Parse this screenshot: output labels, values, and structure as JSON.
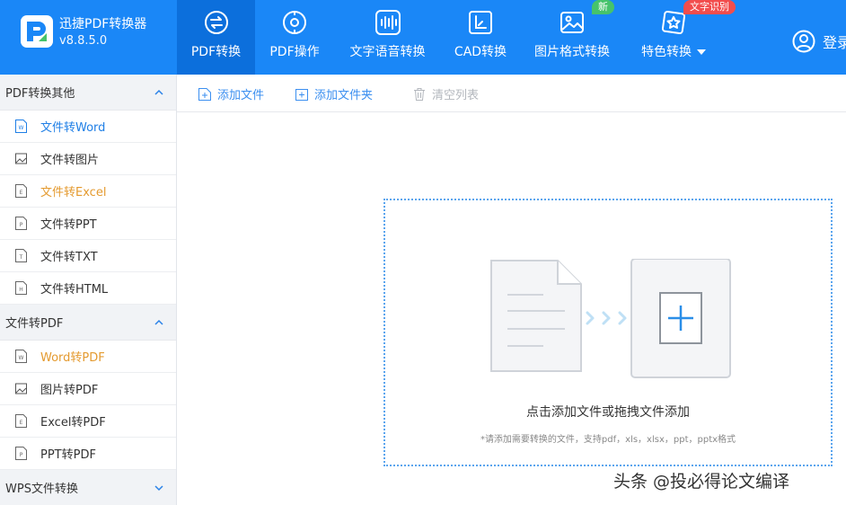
{
  "app": {
    "name": "迅捷PDF转换器",
    "version": "v8.8.5.0",
    "brand_color": "#1a87f7",
    "active_tab_color": "#0c6fdc"
  },
  "nav": {
    "tabs": [
      {
        "label": "PDF转换",
        "icon": "pdf-convert-icon",
        "active": true
      },
      {
        "label": "PDF操作",
        "icon": "pdf-operation-icon",
        "active": false
      },
      {
        "label": "文字语音转换",
        "icon": "voice-wave-icon",
        "active": false
      },
      {
        "label": "CAD转换",
        "icon": "cad-icon",
        "active": false
      },
      {
        "label": "图片格式转换",
        "icon": "image-icon",
        "active": false
      },
      {
        "label": "特色转换",
        "icon": "star-icon",
        "active": false
      }
    ],
    "badge_new": "新",
    "badge_ocr": "文字识别",
    "login_label": "登录"
  },
  "sidebar": {
    "groups": [
      {
        "title": "PDF转换其他",
        "expanded": true,
        "items": [
          {
            "label": "文件转Word",
            "icon": "word-file-icon"
          },
          {
            "label": "文件转图片",
            "icon": "image-file-icon"
          },
          {
            "label": "文件转Excel",
            "icon": "excel-file-icon"
          },
          {
            "label": "文件转PPT",
            "icon": "ppt-file-icon"
          },
          {
            "label": "文件转TXT",
            "icon": "txt-file-icon"
          },
          {
            "label": "文件转HTML",
            "icon": "html-file-icon"
          }
        ]
      },
      {
        "title": "文件转PDF",
        "expanded": true,
        "items": [
          {
            "label": "Word转PDF",
            "icon": "word-file-icon"
          },
          {
            "label": "图片转PDF",
            "icon": "image-file-icon"
          },
          {
            "label": "Excel转PDF",
            "icon": "excel-file-icon"
          },
          {
            "label": "PPT转PDF",
            "icon": "ppt-file-icon"
          }
        ]
      },
      {
        "title": "WPS文件转换",
        "expanded": false,
        "items": []
      }
    ],
    "selected_color": "#1f7fe6",
    "highlight_color": "#e49a2f"
  },
  "toolbar": {
    "add_file": "添加文件",
    "add_folder": "添加文件夹",
    "clear_list": "清空列表"
  },
  "dropzone": {
    "main_text": "点击添加文件或拖拽文件添加",
    "hint_text": "*请添加需要转换的文件，支持pdf，xls，xlsx，ppt，pptx格式",
    "border_color": "#5ba5ee"
  },
  "watermark": "头条 @投必得论文编译"
}
